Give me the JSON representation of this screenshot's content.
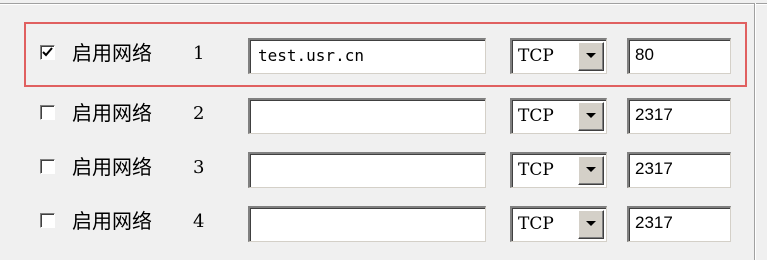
{
  "network_label": "启用网络",
  "rows": [
    {
      "checked": true,
      "index": "1",
      "address": "test.usr.cn",
      "protocol": "TCP",
      "port": "80"
    },
    {
      "checked": false,
      "index": "2",
      "address": "",
      "protocol": "TCP",
      "port": "2317"
    },
    {
      "checked": false,
      "index": "3",
      "address": "",
      "protocol": "TCP",
      "port": "2317"
    },
    {
      "checked": false,
      "index": "4",
      "address": "",
      "protocol": "TCP",
      "port": "2317"
    }
  ],
  "colors": {
    "highlight_border": "#e06060",
    "background": "#f0f0f0"
  },
  "icons": {
    "check": "checkmark-icon",
    "dropdown": "dropdown-arrow-icon"
  }
}
